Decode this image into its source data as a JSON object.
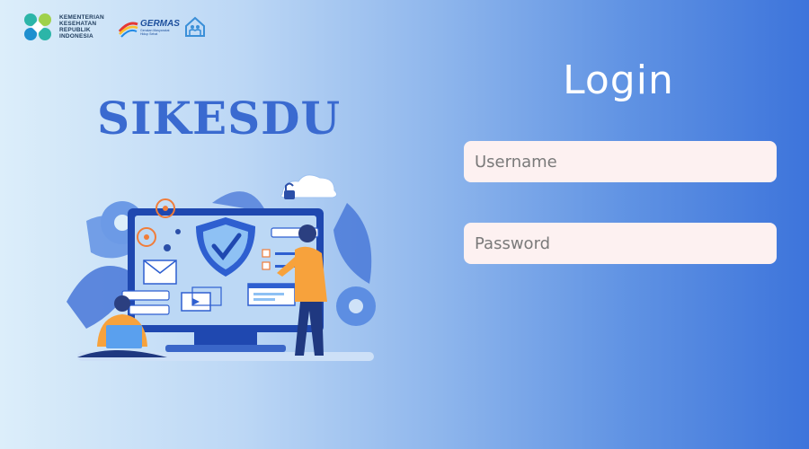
{
  "header": {
    "kemenkes_lines": [
      "KEMENTERIAN",
      "KESEHATAN",
      "REPUBLIK",
      "INDONESIA"
    ],
    "germas_label": "GERMAS",
    "germas_tagline": "Gerakan Masyarakat Hidup Sehat"
  },
  "brand": {
    "title": "SIKESDU"
  },
  "login": {
    "title": "Login",
    "username_placeholder": "Username",
    "password_placeholder": "Password"
  },
  "colors": {
    "brand": "#3a6ad0",
    "field_bg": "#fdf1f1",
    "bg_left": "#dceefa",
    "bg_right": "#3d74db"
  },
  "icons": [
    "kemenkes-logo-icon",
    "germas-logo-icon",
    "home-family-icon",
    "security-illustration"
  ]
}
